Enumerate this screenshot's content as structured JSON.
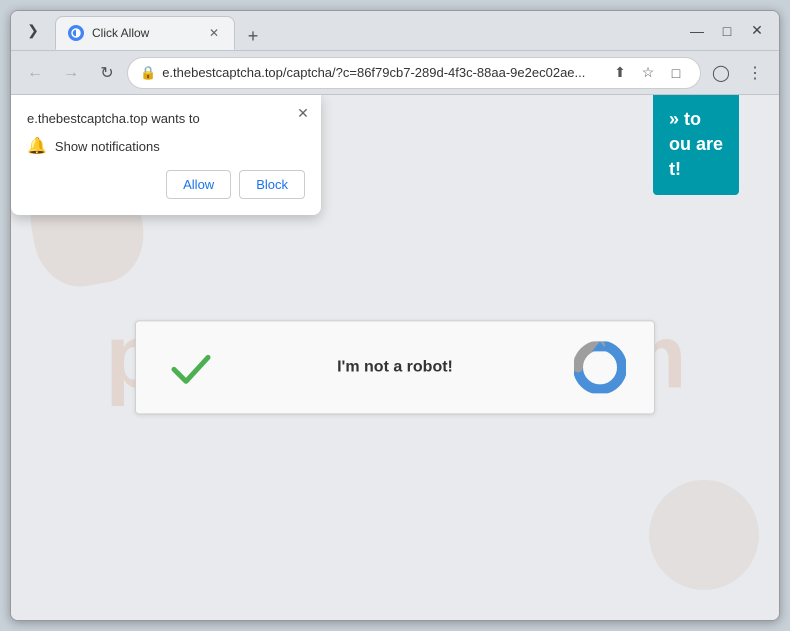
{
  "window": {
    "title": "Click Allow",
    "chevron_icon": "❯",
    "minimize_icon": "—",
    "maximize_icon": "□",
    "close_icon": "✕",
    "new_tab_icon": "+"
  },
  "tab": {
    "title": "Click Allow",
    "close_icon": "✕"
  },
  "nav": {
    "back_icon": "←",
    "forward_icon": "→",
    "reload_icon": "↻",
    "address": "e.thebestcaptcha.top/captcha/?c=86f79cb7-289d-4f3c-88aa-9e2ec02ae...",
    "share_icon": "⬆",
    "bookmark_icon": "☆",
    "extensions_icon": "□",
    "profile_icon": "◯",
    "menu_icon": "⋮"
  },
  "notification_popup": {
    "title": "e.thebestcaptcha.top wants to",
    "permission_label": "Show notifications",
    "allow_label": "Allow",
    "block_label": "Block",
    "close_icon": "✕"
  },
  "site_popup": {
    "line1": "» to",
    "line2": "ou are",
    "line3": "t!"
  },
  "recaptcha": {
    "label": "I'm not a robot!"
  },
  "watermark": "pcfixhelplcom"
}
